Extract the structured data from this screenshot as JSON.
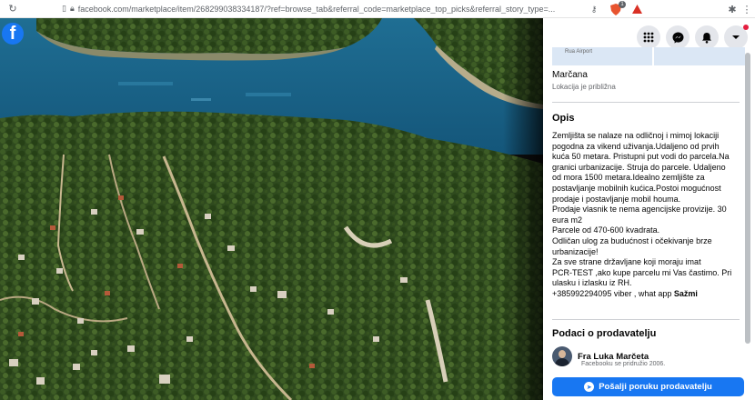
{
  "browser": {
    "url": "facebook.com/marketplace/item/268299038334187/?ref=browse_tab&referral_code=marketplace_top_picks&referral_story_type=...",
    "icons": [
      "reload-icon",
      "bookmark-icon",
      "lock-icon",
      "key-icon",
      "shield-icon",
      "extension-icon",
      "puzzle-icon",
      "more-icon"
    ],
    "badge_count": "1"
  },
  "viewer": {
    "logo_letter": "f"
  },
  "header_icons": [
    "menu-grid-icon",
    "messenger-icon",
    "notifications-icon",
    "account-dropdown-icon"
  ],
  "map": {
    "label": "Rua Airport"
  },
  "location": {
    "name": "Marčana",
    "note": "Lokacija je približna"
  },
  "description": {
    "heading": "Opis",
    "lines": [
      "Zemljišta se nalaze na odličnoj i mimoj lokaciji",
      "pogodna za vikend uživanja.Udaljeno od prvih",
      "kuća 50 metara. Pristupni put vodi do parcela.Na",
      "granici urbanizacije. Struja do parcele. Udaljeno",
      "od mora 1500 metara.Idealno zemljište za",
      "postavljanje mobilnih kućica.Postoi mogućnost",
      "prodaje i postavljanje mobil houma.",
      "Prodaje vlasnik te nema agencijske provizije. 30",
      "eura m2",
      "Parcele od 470-600 kvadrata.",
      "Odličan ulog za budućnost i očekivanje brze",
      "urbanizacije!",
      "Za sve strane državljane koji moraju imat",
      "PCR-TEST ,ako kupe parcelu mi Vas častimo. Pri",
      "ulasku i izlasku iz RH.",
      "+385992294095 viber , what app"
    ],
    "more_label": "Sažmi"
  },
  "seller": {
    "heading": "Podaci o prodavatelju",
    "name": "Fra Luka Marčeta",
    "since": "Facebooku se pridružio 2006."
  },
  "message_button": {
    "label": "Pošalji poruku prodavatelju"
  }
}
